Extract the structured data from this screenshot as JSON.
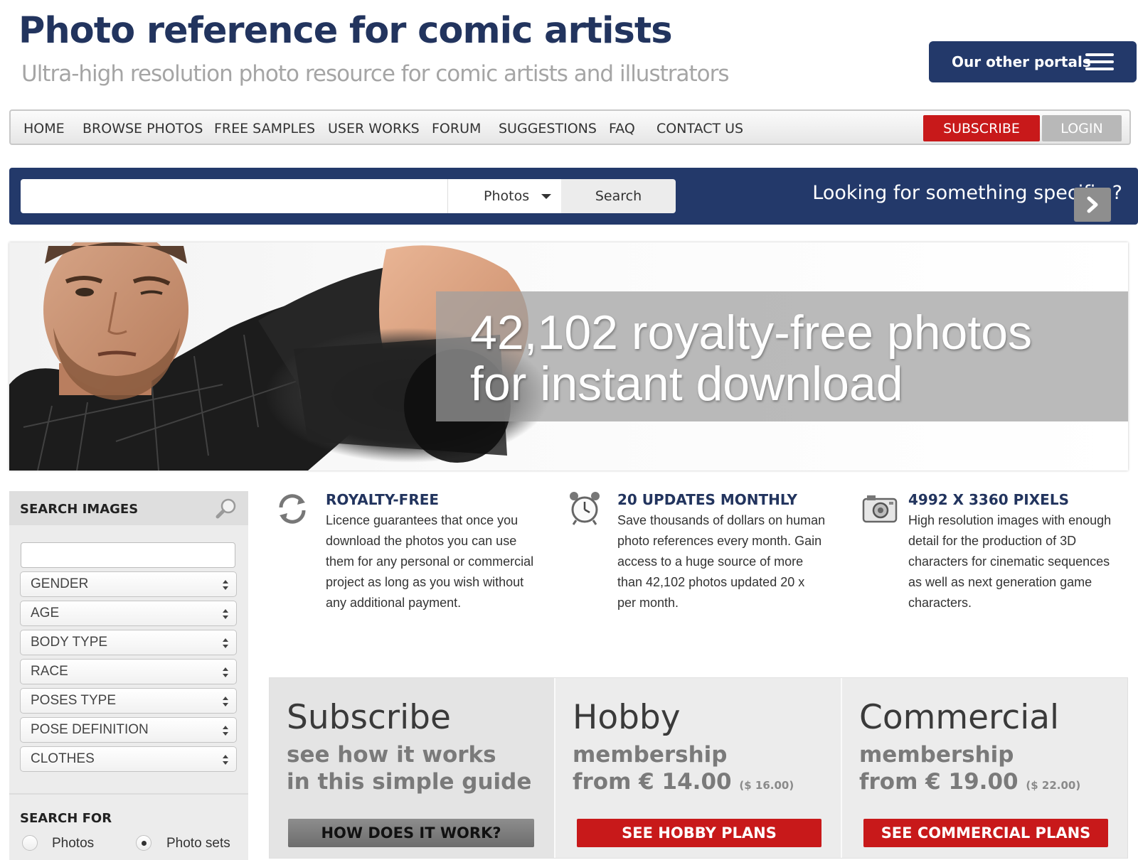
{
  "header": {
    "title": "Photo reference for comic artists",
    "subtitle": "Ultra-high resolution photo resource for comic artists and illustrators",
    "portals_label": "Our other portals"
  },
  "nav": {
    "items": [
      "HOME",
      "BROWSE PHOTOS",
      "FREE SAMPLES",
      "USER WORKS",
      "FORUM",
      "SUGGESTIONS",
      "FAQ",
      "CONTACT US"
    ],
    "subscribe_label": "SUBSCRIBE",
    "login_label": "LOGIN"
  },
  "search": {
    "query": "",
    "type_selected": "Photos",
    "button_label": "Search",
    "tagline": "Looking for something specific ?"
  },
  "hero": {
    "line1": "42,102 royalty-free photos",
    "line2": "for instant download"
  },
  "sidebar": {
    "title": "SEARCH IMAGES",
    "keyword": "",
    "filters": [
      "GENDER",
      "AGE",
      "BODY TYPE",
      "RACE",
      "POSES TYPE",
      "POSE DEFINITION",
      "CLOTHES"
    ],
    "search_for_title": "SEARCH FOR",
    "options": [
      {
        "label": "Photos",
        "selected": false
      },
      {
        "label": "Photo sets",
        "selected": true
      }
    ]
  },
  "features": [
    {
      "icon": "refresh-icon",
      "title": "ROYALTY-FREE",
      "lines": [
        "Licence guarantees that once you",
        "download the photos you can use",
        "them for any personal or commercial",
        "project as long as you wish without",
        "any additional payment."
      ]
    },
    {
      "icon": "alarm-clock-icon",
      "title": "20 UPDATES MONTHLY",
      "lines": [
        "Save thousands of dollars on human",
        "photo references every month. Gain",
        "access to a huge source of more",
        "than 42,102 photos updated 20 x",
        "per month."
      ]
    },
    {
      "icon": "camera-icon",
      "title": "4992 x 3360 PIXELS",
      "lines": [
        "High resolution images with enough",
        "detail for the production of 3D",
        "characters for cinematic sequences",
        "as well as next generation game",
        "characters."
      ]
    }
  ],
  "plans": [
    {
      "title": "Subscribe",
      "line1": "see how it works",
      "line2": "in this simple guide",
      "price_usd": "",
      "button": "HOW DOES IT WORK?"
    },
    {
      "title": "Hobby",
      "line1": "membership",
      "line2": "from € 14.00",
      "price_usd": "($ 16.00)",
      "button": "SEE HOBBY PLANS"
    },
    {
      "title": "Commercial",
      "line1": "membership",
      "line2": "from € 19.00",
      "price_usd": "($ 22.00)",
      "button": "SEE COMMERCIAL PLANS"
    }
  ],
  "colors": {
    "brand_navy": "#23396a",
    "accent_red": "#c8191a",
    "subtitle_gray": "#a5a5a5"
  }
}
